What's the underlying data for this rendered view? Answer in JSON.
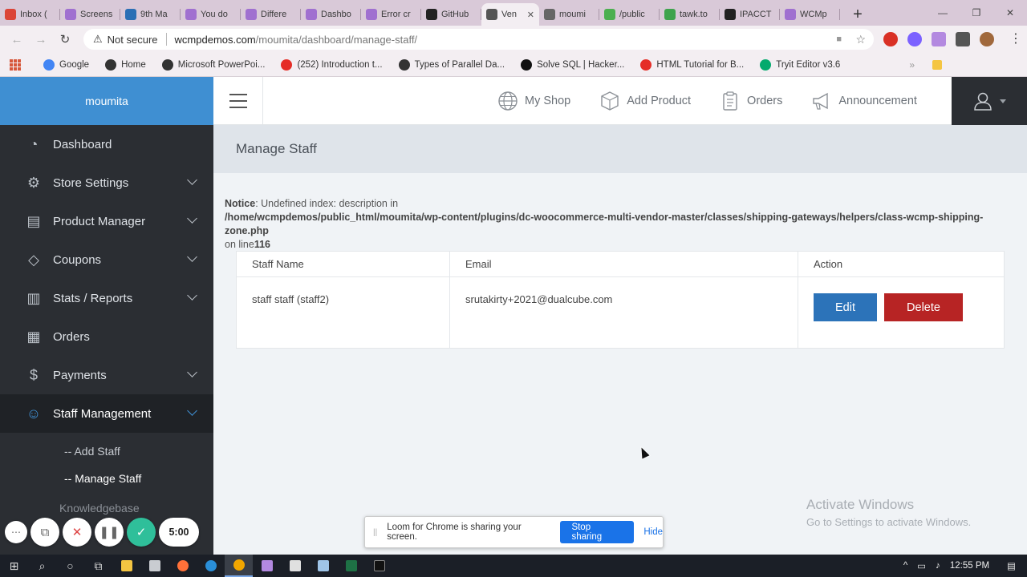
{
  "browser": {
    "tabs": [
      {
        "label": "Inbox (",
        "color": "#db4437"
      },
      {
        "label": "Screens",
        "color": "#a070d0"
      },
      {
        "label": "9th Ma",
        "color": "#2b6fb5"
      },
      {
        "label": "You do",
        "color": "#a070d0"
      },
      {
        "label": "Differe",
        "color": "#a070d0"
      },
      {
        "label": "Dashbo",
        "color": "#a070d0"
      },
      {
        "label": "Error cr",
        "color": "#a070d0"
      },
      {
        "label": "GitHub",
        "color": "#222222"
      },
      {
        "label": "Ven",
        "color": "#555555",
        "active": true
      },
      {
        "label": "moumi",
        "color": "#666666"
      },
      {
        "label": "/public",
        "color": "#4caf50"
      },
      {
        "label": "tawk.to",
        "color": "#3fa34d"
      },
      {
        "label": "IPACCT",
        "color": "#222222"
      },
      {
        "label": "WCMp",
        "color": "#a070d0"
      }
    ],
    "tab_close": "✕",
    "new_tab": "+",
    "security_label": "Not secure",
    "url_host": "wcmpdemos.com",
    "url_path": "/moumita/dashboard/manage-staff/",
    "bookmarks": [
      {
        "label": "Google",
        "color": "#4285f4"
      },
      {
        "label": "Home",
        "color": "#333333"
      },
      {
        "label": "Microsoft PowerPoi...",
        "color": "#333333"
      },
      {
        "label": "(252) Introduction t...",
        "color": "#e52d27"
      },
      {
        "label": "Types of Parallel Da...",
        "color": "#333333"
      },
      {
        "label": "Solve SQL | Hacker...",
        "color": "#111111"
      },
      {
        "label": "HTML Tutorial for B...",
        "color": "#e52d27"
      },
      {
        "label": "Tryit Editor v3.6",
        "color": "#04aa6d"
      }
    ],
    "bookmarks_more": "»"
  },
  "sidebar": {
    "brand": "moumita",
    "items": [
      {
        "label": "Dashboard",
        "icon": "◔",
        "expandable": false
      },
      {
        "label": "Store Settings",
        "icon": "⚙",
        "expandable": true
      },
      {
        "label": "Product Manager",
        "icon": "▤",
        "expandable": true
      },
      {
        "label": "Coupons",
        "icon": "◇",
        "expandable": true
      },
      {
        "label": "Stats / Reports",
        "icon": "▥",
        "expandable": true
      },
      {
        "label": "Orders",
        "icon": "▦",
        "expandable": false
      },
      {
        "label": "Payments",
        "icon": "$",
        "expandable": true
      },
      {
        "label": "Staff Management",
        "icon": "☺",
        "expandable": true,
        "active": true
      }
    ],
    "subitems": [
      {
        "label": "-- Add Staff"
      },
      {
        "label": "-- Manage Staff",
        "current": true
      }
    ],
    "cut_item": "Knowledgebase"
  },
  "topbar": {
    "links": [
      {
        "label": "My Shop",
        "icon": "globe-icon"
      },
      {
        "label": "Add Product",
        "icon": "box-icon"
      },
      {
        "label": "Orders",
        "icon": "clipboard-icon"
      },
      {
        "label": "Announcement",
        "icon": "megaphone-icon"
      }
    ]
  },
  "page": {
    "title": "Manage Staff",
    "notice_label": "Notice",
    "notice_text": ": Undefined index: description in",
    "notice_path": "/home/wcmpdemos/public_html/moumita/wp-content/plugins/dc-woocommerce-multi-vendor-master/classes/shipping-gateways/helpers/class-wcmp-shipping-zone.php",
    "notice_line_prefix": "on line",
    "notice_line": "116"
  },
  "staff_table": {
    "columns": [
      "Staff Name",
      "Email",
      "Action"
    ],
    "rows": [
      {
        "name": "staff staff (staff2)",
        "email": "srutakirty+2021@dualcube.com",
        "edit_label": "Edit",
        "delete_label": "Delete"
      }
    ]
  },
  "watermark": {
    "title": "Activate Windows",
    "subtitle": "Go to Settings to activate Windows."
  },
  "loom": {
    "share_text": "Loom for Chrome is sharing your screen.",
    "stop_label": "Stop sharing",
    "hide_label": "Hide",
    "timer": "5:00"
  },
  "taskbar": {
    "time": "12:55 PM"
  },
  "colors": {
    "sidebar_bg": "#2b2e33",
    "brand_bg": "#3f8fd2",
    "edit_button": "#2c73b9",
    "delete_button": "#b72424"
  }
}
